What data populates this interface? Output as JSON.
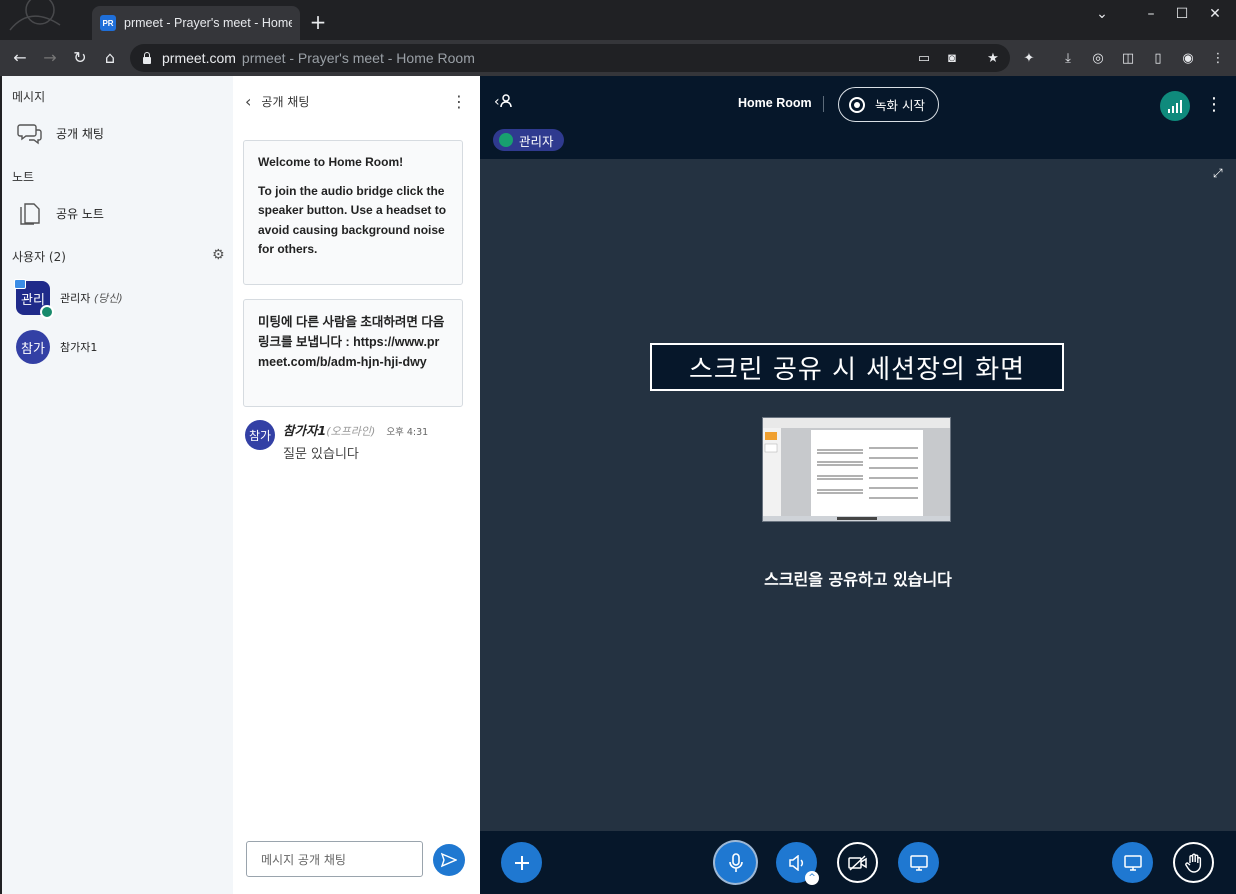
{
  "browser": {
    "tab_title": "prmeet - Prayer's meet - Home Room",
    "tab_favicon_text": "PR",
    "url_host": "prmeet.com",
    "url_rest": "prmeet - Prayer's meet - Home Room"
  },
  "sidebar": {
    "messages_heading": "메시지",
    "public_chat_label": "공개 채팅",
    "notes_heading": "노트",
    "shared_notes_label": "공유 노트",
    "users_heading": "사용자 (2)",
    "users": [
      {
        "avatar": "관리",
        "name": "관리자",
        "tag": "(당신)"
      },
      {
        "avatar": "참가",
        "name": "참가자1",
        "tag": ""
      }
    ]
  },
  "chat": {
    "title": "공개 채팅",
    "welcome_title_prefix": "Welcome to ",
    "welcome_title_room": "Home Room",
    "welcome_title_suffix": "!",
    "welcome_body": "To join the audio bridge click the speaker button. Use a headset to avoid causing background noise for others.",
    "invite_text": "미팅에 다른 사람을 초대하려면 다음 링크를 보냅니다 : https://www.prmeet.com/b/adm-hjn-hji-dwy",
    "message": {
      "avatar": "참가",
      "name": "참가자1",
      "status": "(오프라인)",
      "time": "오후 4:31",
      "text": "질문 있습니다"
    },
    "input_placeholder": "메시지 공개 채팅"
  },
  "main": {
    "room_title": "Home Room",
    "record_label": "녹화 시작",
    "presenter_label": "관리자",
    "annotation": "스크린 공유 시 세션장의 화면",
    "sharing_text": "스크린을 공유하고 있습니다"
  },
  "colors": {
    "accent": "#1f78d1",
    "main_bg": "#06172a",
    "stage_bg": "#243241",
    "sidebar_bg": "#f3f6f9",
    "connection": "#0f8a7c"
  }
}
